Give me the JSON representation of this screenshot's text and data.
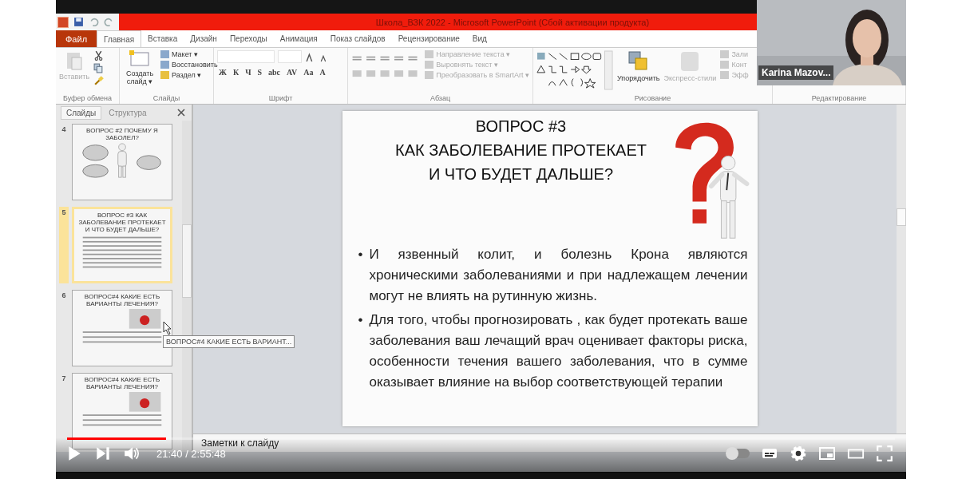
{
  "app": {
    "title": "Школа_ВЗК 2022 - Microsoft PowerPoint (Сбой активации продукта)",
    "tabs": [
      {
        "label": "Файл",
        "kind": "file",
        "selected": false
      },
      {
        "label": "Главная",
        "kind": "tab",
        "selected": true
      },
      {
        "label": "Вставка",
        "kind": "tab",
        "selected": false
      },
      {
        "label": "Дизайн",
        "kind": "tab",
        "selected": false
      },
      {
        "label": "Переходы",
        "kind": "tab",
        "selected": false
      },
      {
        "label": "Анимация",
        "kind": "tab",
        "selected": false
      },
      {
        "label": "Показ слайдов",
        "kind": "tab",
        "selected": false
      },
      {
        "label": "Рецензирование",
        "kind": "tab",
        "selected": false
      },
      {
        "label": "Вид",
        "kind": "tab",
        "selected": false
      }
    ],
    "ribbon": {
      "clipboard": {
        "label": "Буфер обмена",
        "paste": "Вставить"
      },
      "slides": {
        "label": "Слайды",
        "new_slide": "Создать слайд ▾",
        "layout": "Макет ▾",
        "reset": "Восстановить",
        "section": "Раздел ▾"
      },
      "font": {
        "label": "Шрифт",
        "buttons": [
          "Ж",
          "К",
          "Ч",
          "S",
          "abc",
          "AV",
          "Aa",
          "A"
        ]
      },
      "paragraph": {
        "label": "Абзац",
        "direction": "Направление текста ▾",
        "align": "Выровнять текст ▾",
        "smartart": "Преобразовать в SmartArt ▾"
      },
      "drawing": {
        "label": "Рисование",
        "arrange": "Упорядочить",
        "quick_styles": "Экспресс-стили",
        "fill": "Зали",
        "outline": "Конт",
        "effects": "Эфф"
      },
      "editing": {
        "label": "Редактирование"
      }
    },
    "panel_tabs": [
      {
        "label": "Слайды",
        "selected": true
      },
      {
        "label": "Структура",
        "selected": false
      }
    ],
    "slides": [
      {
        "number": "4",
        "kind": "figure",
        "selected": false,
        "title": "ВОПРОС #2 ПОЧЕМУ Я ЗАБОЛЕЛ?"
      },
      {
        "number": "5",
        "kind": "question",
        "selected": true,
        "title": "ВОПРОС #3 КАК ЗАБОЛЕВАНИЕ ПРОТЕКАЕТ И ЧТО БУДЕТ ДАЛЬШЕ?"
      },
      {
        "number": "6",
        "kind": "puzzle",
        "selected": false,
        "title": "ВОПРОС#4 КАКИЕ ЕСТЬ ВАРИАНТЫ ЛЕЧЕНИЯ?"
      },
      {
        "number": "7",
        "kind": "puzzle",
        "selected": false,
        "title": "ВОПРОС#4 КАКИЕ ЕСТЬ ВАРИАНТЫ ЛЕЧЕНИЯ?"
      }
    ],
    "tooltip": "ВОПРОС#4 КАКИЕ ЕСТЬ ВАРИАНТ...",
    "slide": {
      "marker": "•",
      "title": [
        "ВОПРОС #3",
        "КАК ЗАБОЛЕВАНИЕ ПРОТЕКАЕТ",
        "И ЧТО БУДЕТ ДАЛЬШЕ?"
      ],
      "bullets": [
        "И язвенный колит, и болезнь Крона являются хроническими заболеваниями и при надлежащем лечении могут не влиять на рутинную жизнь.",
        "Для того, чтобы прогнозировать , как будет протекать ваше заболевания ваш лечащий врач оценивает факторы риска, особенности течения вашего заболевания, что в сумме оказывает влияние на выбор соответствующей терапии"
      ]
    },
    "notes": "Заметки к слайду"
  },
  "webcam": {
    "name": "Karina Mazov..."
  },
  "player": {
    "progress": {
      "level": 0.12
    },
    "time": "21:40 / 2:55:48",
    "autoplay": {
      "on": false
    }
  }
}
